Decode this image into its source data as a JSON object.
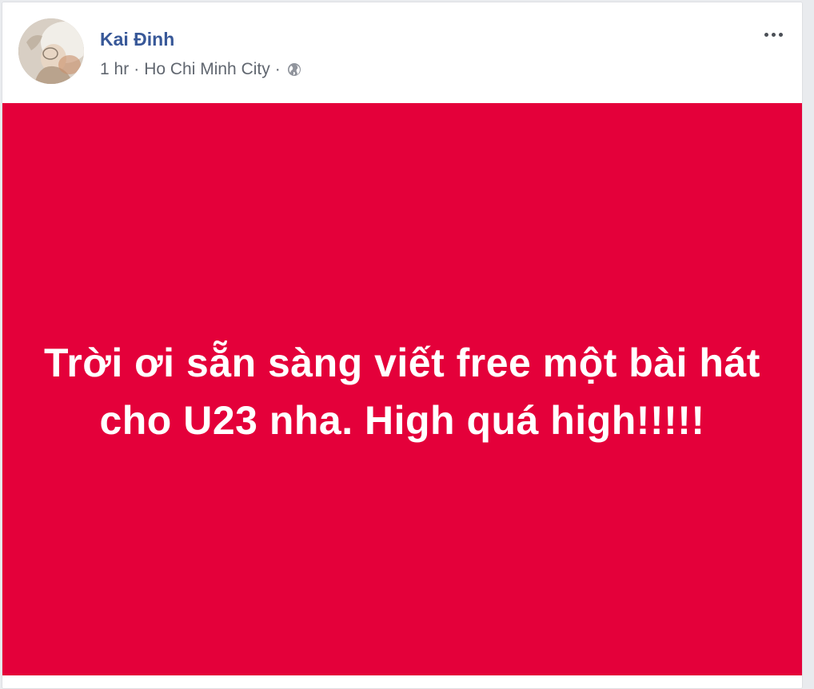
{
  "post": {
    "author_name": "Kai Đinh",
    "time": "1 hr",
    "separator": "·",
    "location": "Ho Chi Minh City",
    "privacy_icon": "globe-icon",
    "more_icon": "more-options-icon",
    "text": "Trời ơi sẵn sàng viết free một bài hát cho U23 nha. High quá high!!!!!",
    "background_color": "#e4003a",
    "text_color": "#ffffff",
    "author_color": "#385898"
  }
}
